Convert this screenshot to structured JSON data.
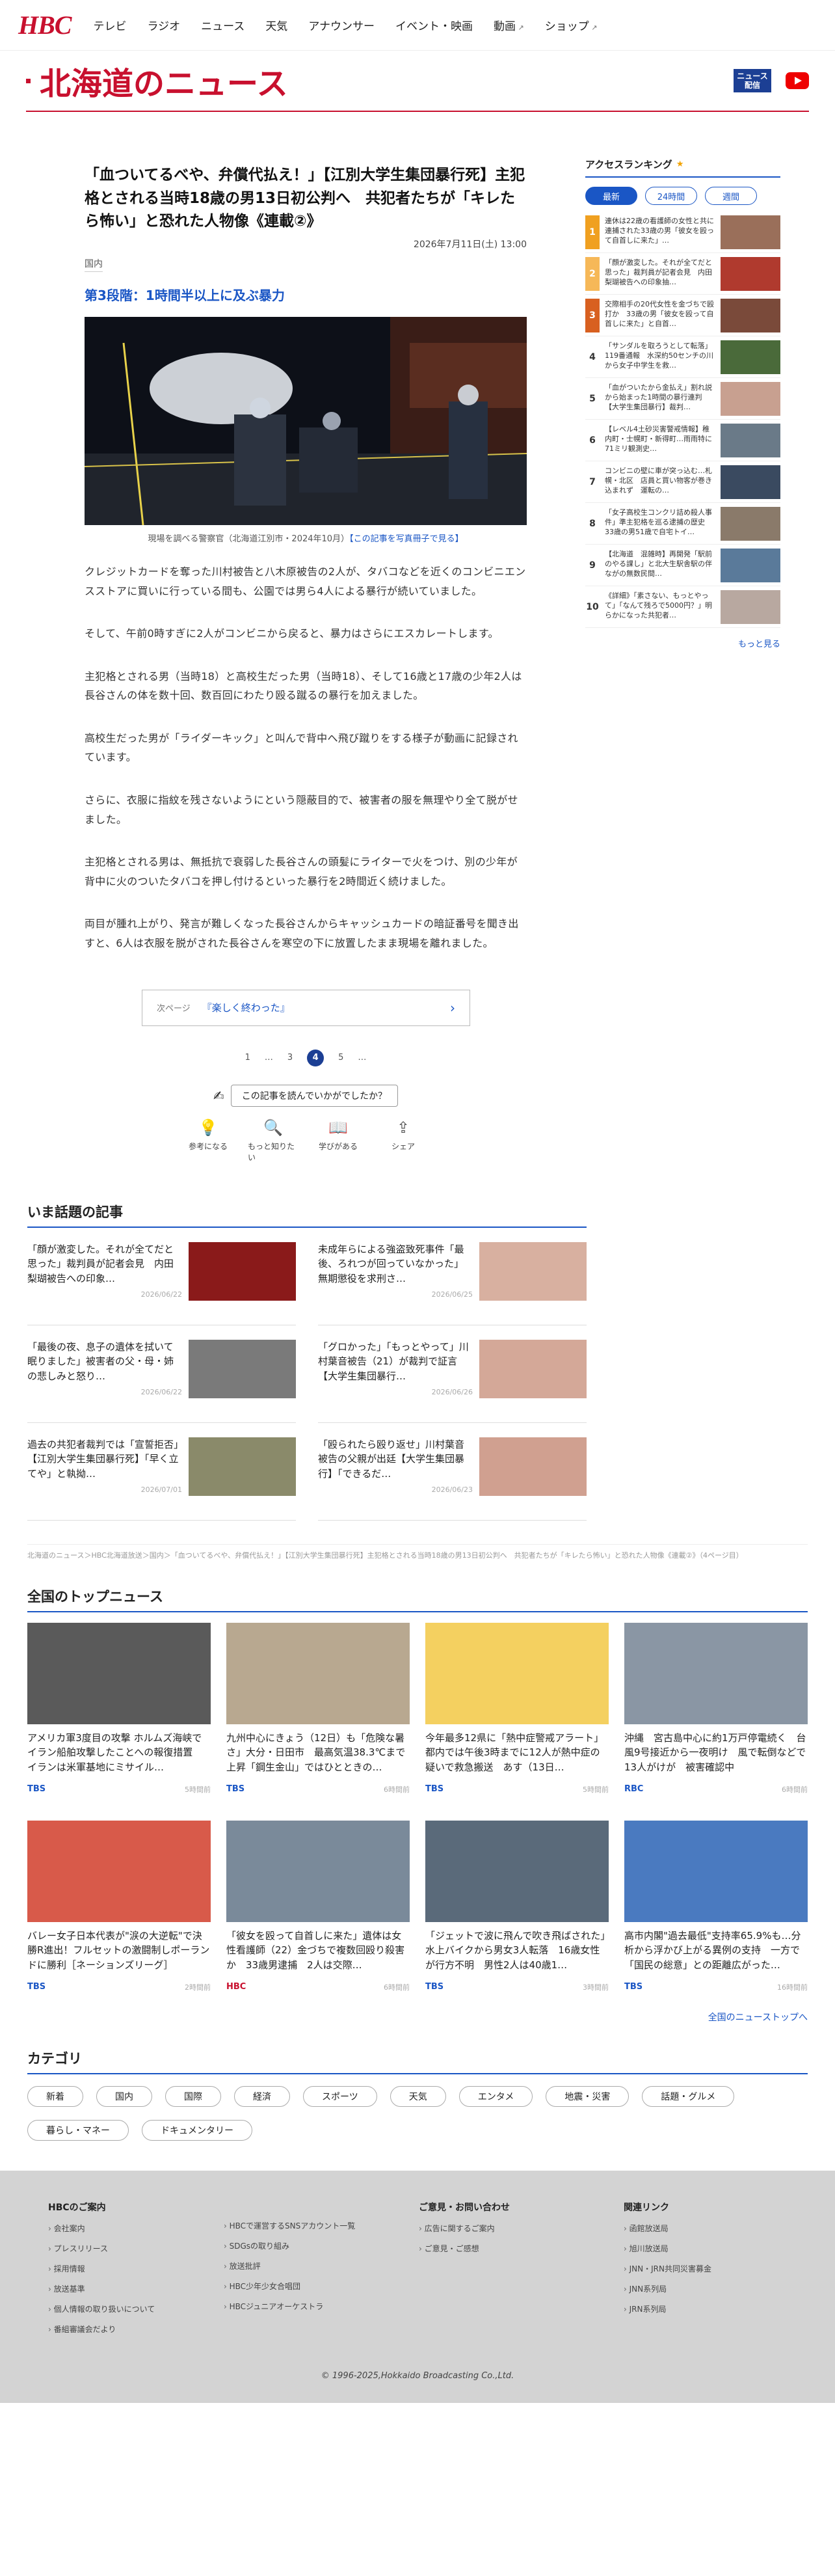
{
  "nav": {
    "logo": "HBC",
    "items": [
      "テレビ",
      "ラジオ",
      "ニュース",
      "天気",
      "アナウンサー",
      "イベント・映画",
      "動画",
      "ショップ"
    ]
  },
  "section": {
    "title": "北海道のニュース",
    "news_badge": "ニュース\n配信"
  },
  "article": {
    "title": "「血ついてるべや、弁償代払え！」【江別大学生集団暴行死】主犯格とされる当時18歳の男13日初公判へ　共犯者たちが「キレたら怖い」と恐れた人物像《連載②》",
    "date": "2026年7月11日(土) 13:00",
    "category": "国内",
    "subheading": "第3段階：1時間半以上に及ぶ暴力",
    "caption": "現場を調べる警察官（北海道江別市・2024年10月）",
    "caption_link": "【この記事を写真冊子で見る】",
    "paragraphs": [
      "クレジットカードを奪った川村被告と八木原被告の2人が、タバコなどを近くのコンビニエンスストアに買いに行っている間も、公園では男ら4人による暴行が続いていました。",
      "そして、午前0時すぎに2人がコンビニから戻ると、暴力はさらにエスカレートします。",
      "主犯格とされる男（当時18）と高校生だった男（当時18）、そして16歳と17歳の少年2人は長谷さんの体を数十回、数百回にわたり殴る蹴るの暴行を加えました。",
      "高校生だった男が「ライダーキック」と叫んで背中へ飛び蹴りをする様子が動画に記録されています。",
      "さらに、衣服に指紋を残さないようにという隠蔽目的で、被害者の服を無理やり全て脱がせました。",
      "主犯格とされる男は、無抵抗で衰弱した長谷さんの頭髪にライターで火をつけ、別の少年が背中に火のついたタバコを押し付けるといった暴行を2時間近く続けました。",
      "両目が腫れ上がり、発言が難しくなった長谷さんからキャッシュカードの暗証番号を聞き出すと、6人は衣服を脱がされた長谷さんを寒空の下に放置したまま現場を離れました。"
    ],
    "next_label": "次ページ",
    "next_title": "『楽しく終わった』",
    "pager": [
      "1",
      "…",
      "3",
      "4",
      "5",
      "…"
    ],
    "feedback_q": "この記事を読んでいかがでしたか？",
    "reactions": [
      "参考になる",
      "もっと知りたい",
      "学びがある",
      "シェア"
    ]
  },
  "ranking": {
    "title": "アクセスランキング",
    "tabs": [
      "最新",
      "24時間",
      "週間"
    ],
    "items": [
      {
        "n": "1",
        "t": "連休は22歳の看護師の女性と共に　連捕された33歳の男「彼女を殴って自首しに来た」…"
      },
      {
        "n": "2",
        "t": "「顔が激変した。それが全てだと思った」裁判員が記者会見　内田梨瑚被告への印象抽…"
      },
      {
        "n": "3",
        "t": "交際相手の20代女性を金づちで殴打か　33歳の男「彼女を殴って自首しに来た」と自首…"
      },
      {
        "n": "4",
        "t": "「サンダルを取ろうとして転落」119番通報　水深約50センチの川から女子中学生を救…"
      },
      {
        "n": "5",
        "t": "「血がついたから金払え」割れ説から始まった1時間の暴行連判【大学生集団暴行】裁判…"
      },
      {
        "n": "6",
        "t": "【レベル4土砂災害警戒情報】稚内町・士幌町・新得町…雨雨特に71ミリ観測史…"
      },
      {
        "n": "7",
        "t": "コンビニの壁に車が突っ込む…札幌・北区　店員と買い物客が巻き込まれず　運転の…"
      },
      {
        "n": "8",
        "t": "「女子高校生コンクリ詰め殺人事件」準主犯格を巡る逮捕の歴史　33歳の男51歳で自宅トイ…"
      },
      {
        "n": "9",
        "t": "【北海道　混雑時】再開発「駅前のやる課し」と北大生駅舎駅の伴ながの無数民間…"
      },
      {
        "n": "10",
        "t": "《詳細》「素さない、もっとやって」「なんて残ろで5000円？」明らかになった共犯者…"
      }
    ],
    "more": "もっと見る"
  },
  "hot": {
    "title": "いま話題の記事",
    "items": [
      {
        "t": "「顔が激変した。それが全てだと思った」裁判員が記者会見　内田梨瑚被告への印象…",
        "d": "2026/06/22"
      },
      {
        "t": "未成年らによる強盗致死事件「最後、ろれつが回っていなかった」無期懲役を求刑さ…",
        "d": "2026/06/25"
      },
      {
        "t": "「最後の夜、息子の遺体を拭いて眠りました」被害者の父・母・姉の悲しみと怒り…",
        "d": "2026/06/22"
      },
      {
        "t": "「グロかった」「もっとやって」川村葉音被告（21）が裁判で証言【大学生集団暴行…",
        "d": "2026/06/26"
      },
      {
        "t": "過去の共犯者裁判では「宣誓拒否」【江別大学生集団暴行死】「早く立てや」と執拗…",
        "d": "2026/07/01"
      },
      {
        "t": "「殴られたら殴り返せ」川村葉音被告の父親が出廷【大学生集団暴行】「できるだ…",
        "d": "2026/06/23"
      }
    ]
  },
  "breadcrumb": "北海道のニュース＞HBC北海道放送＞国内＞「血ついてるべや、弁償代払え！」【江別大学生集団暴行死】主犯格とされる当時18歳の男13日初公判へ　共犯者たちが「キレたら怖い」と恐れた人物像《連載②》（4ページ目）",
  "top": {
    "title": "全国のトップニュース",
    "items": [
      {
        "t": "アメリカ軍3度目の攻撃 ホルムズ海峡でイラン船舶攻撃したことへの報復措置　イランは米軍基地にミサイル…",
        "s": "TBS",
        "a": "5時間前"
      },
      {
        "t": "九州中心にきょう（12日）も「危険な暑さ」大分・日田市　最高気温38.3℃まで上昇「鋼生金山」ではひとときの…",
        "s": "TBS",
        "a": "6時間前"
      },
      {
        "t": "今年最多12県に「熱中症警戒アラート」都内では午後3時までに12人が熱中症の疑いで救急搬送　あす（13日…",
        "s": "TBS",
        "a": "5時間前"
      },
      {
        "t": "沖縄　宮古島中心に約1万戸停電続く　台風9号接近から一夜明け　風で転倒などで13人がけが　被害確認中",
        "s": "RBC",
        "a": "6時間前"
      },
      {
        "t": "バレー女子日本代表が\"涙の大逆転\"で決勝R進出！フルセットの激闘制しポーランドに勝利［ネーションズリーグ］",
        "s": "TBS",
        "a": "2時間前"
      },
      {
        "t": "「彼女を殴って自首しに来た」遺体は女性看護師（22）金づちで複数回殴り殺害か　33歳男逮捕　2人は交際…",
        "s": "HBC",
        "a": "6時間前"
      },
      {
        "t": "「ジェットで波に飛んで吹き飛ばされた」水上バイクから男女3人転落　16歳女性が行方不明　男性2人は40歳1…",
        "s": "TBS",
        "a": "3時間前"
      },
      {
        "t": "高市内閣\"過去最低\"支持率65.9%も…分析から浮かび上がる異例の支持　一方で「国民の総意」との距離広がった…",
        "s": "TBS",
        "a": "16時間前"
      }
    ],
    "all": "全国のニューストップへ"
  },
  "categories": {
    "title": "カテゴリ",
    "items": [
      "新着",
      "国内",
      "国際",
      "経済",
      "スポーツ",
      "天気",
      "エンタメ",
      "地震・災害",
      "話題・グルメ",
      "暮らし・マネー",
      "ドキュメンタリー"
    ]
  },
  "footer": {
    "cols": [
      {
        "h": "HBCのご案内",
        "i": [
          "会社案内",
          "プレスリリース",
          "採用情報",
          "放送基準",
          "個人情報の取り扱いについて",
          "番組審議会だより"
        ]
      },
      {
        "h": "",
        "i": [
          "HBCで運営するSNSアカウント一覧",
          "SDGsの取り組み",
          "放送批評",
          "HBC少年少女合唱団",
          "HBCジュニアオーケストラ"
        ]
      },
      {
        "h": "ご意見・お問い合わせ",
        "i": [
          "広告に関するご案内",
          "ご意見・ご感想"
        ]
      },
      {
        "h": "関連リンク",
        "i": [
          "函館放送局",
          "旭川放送局",
          "JNN・JRN共同災害募金",
          "JNN系列局",
          "JRN系列局"
        ]
      }
    ],
    "copyright": "© 1996-2025,Hokkaido Broadcasting Co.,Ltd."
  },
  "colors": {
    "brand": "#c8102e",
    "accent": "#1a56c5"
  }
}
